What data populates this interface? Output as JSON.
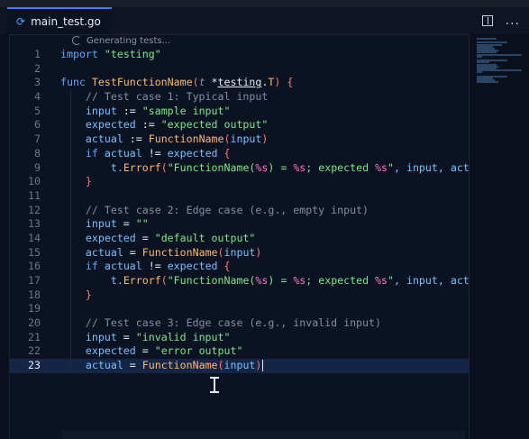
{
  "tab": {
    "icon": "go-file-icon",
    "filename": "main_test.go",
    "dirty_indicator": "modified-dot-icon"
  },
  "editor_actions": {
    "split": "split-editor-icon",
    "more": "more-actions-icon",
    "more_glyph": "..."
  },
  "status": {
    "text": "Generating tests..."
  },
  "code": {
    "lines": [
      {
        "n": "1",
        "tokens": [
          {
            "t": "import ",
            "c": "kw"
          },
          {
            "t": "\"testing\"",
            "c": "str"
          }
        ]
      },
      {
        "n": "2",
        "tokens": []
      },
      {
        "n": "3",
        "tokens": [
          {
            "t": "func ",
            "c": "kw"
          },
          {
            "t": "TestFunctionName",
            "c": "fn"
          },
          {
            "t": "(",
            "c": "punc"
          },
          {
            "t": "t",
            "c": "inlay"
          },
          {
            "t": " *",
            "c": "op"
          },
          {
            "t": "testing",
            "c": "ty ul"
          },
          {
            "t": ".",
            "c": "op"
          },
          {
            "t": "T",
            "c": "fn"
          },
          {
            "t": ") ",
            "c": "punc"
          },
          {
            "t": "{",
            "c": "punc"
          }
        ]
      },
      {
        "n": "4",
        "tokens": [
          {
            "t": "    // Test case 1: Typical input",
            "c": "cm"
          }
        ]
      },
      {
        "n": "5",
        "tokens": [
          {
            "t": "    input",
            "c": "id"
          },
          {
            "t": " := ",
            "c": "op"
          },
          {
            "t": "\"sample input\"",
            "c": "str"
          }
        ]
      },
      {
        "n": "6",
        "tokens": [
          {
            "t": "    expected",
            "c": "id"
          },
          {
            "t": " := ",
            "c": "op"
          },
          {
            "t": "\"expected output\"",
            "c": "str"
          }
        ]
      },
      {
        "n": "7",
        "tokens": [
          {
            "t": "    actual",
            "c": "id"
          },
          {
            "t": " := ",
            "c": "op"
          },
          {
            "t": "FunctionName",
            "c": "fn"
          },
          {
            "t": "(",
            "c": "punc"
          },
          {
            "t": "input",
            "c": "id"
          },
          {
            "t": ")",
            "c": "punc"
          }
        ]
      },
      {
        "n": "8",
        "tokens": [
          {
            "t": "    if ",
            "c": "kw"
          },
          {
            "t": "actual",
            "c": "id"
          },
          {
            "t": " != ",
            "c": "op"
          },
          {
            "t": "expected",
            "c": "id"
          },
          {
            "t": " {",
            "c": "punc"
          }
        ]
      },
      {
        "n": "9",
        "tokens": [
          {
            "t": "        t.",
            "c": "id"
          },
          {
            "t": "Errorf",
            "c": "fn"
          },
          {
            "t": "(",
            "c": "punc"
          },
          {
            "t": "\"FunctionName(",
            "c": "str"
          },
          {
            "t": "%s",
            "c": "fmt"
          },
          {
            "t": ") = ",
            "c": "str"
          },
          {
            "t": "%s",
            "c": "fmt"
          },
          {
            "t": "; expected ",
            "c": "str"
          },
          {
            "t": "%s",
            "c": "fmt"
          },
          {
            "t": "\"",
            "c": "str"
          },
          {
            "t": ", input, act",
            "c": "id"
          }
        ]
      },
      {
        "n": "10",
        "tokens": [
          {
            "t": "    }",
            "c": "punc"
          }
        ]
      },
      {
        "n": "11",
        "tokens": []
      },
      {
        "n": "12",
        "tokens": [
          {
            "t": "    // Test case 2: Edge case (e.g., empty input)",
            "c": "cm"
          }
        ]
      },
      {
        "n": "13",
        "tokens": [
          {
            "t": "    input",
            "c": "id"
          },
          {
            "t": " = ",
            "c": "op"
          },
          {
            "t": "\"\"",
            "c": "str"
          }
        ]
      },
      {
        "n": "14",
        "tokens": [
          {
            "t": "    expected",
            "c": "id"
          },
          {
            "t": " = ",
            "c": "op"
          },
          {
            "t": "\"default output\"",
            "c": "str"
          }
        ]
      },
      {
        "n": "15",
        "tokens": [
          {
            "t": "    actual",
            "c": "id"
          },
          {
            "t": " = ",
            "c": "op"
          },
          {
            "t": "FunctionName",
            "c": "fn"
          },
          {
            "t": "(",
            "c": "punc"
          },
          {
            "t": "input",
            "c": "id"
          },
          {
            "t": ")",
            "c": "punc"
          }
        ]
      },
      {
        "n": "16",
        "tokens": [
          {
            "t": "    if ",
            "c": "kw"
          },
          {
            "t": "actual",
            "c": "id"
          },
          {
            "t": " != ",
            "c": "op"
          },
          {
            "t": "expected",
            "c": "id"
          },
          {
            "t": " {",
            "c": "punc"
          }
        ]
      },
      {
        "n": "17",
        "tokens": [
          {
            "t": "        t.",
            "c": "id"
          },
          {
            "t": "Errorf",
            "c": "fn"
          },
          {
            "t": "(",
            "c": "punc"
          },
          {
            "t": "\"FunctionName(",
            "c": "str"
          },
          {
            "t": "%s",
            "c": "fmt"
          },
          {
            "t": ") = ",
            "c": "str"
          },
          {
            "t": "%s",
            "c": "fmt"
          },
          {
            "t": "; expected ",
            "c": "str"
          },
          {
            "t": "%s",
            "c": "fmt"
          },
          {
            "t": "\"",
            "c": "str"
          },
          {
            "t": ", input, act",
            "c": "id"
          }
        ]
      },
      {
        "n": "18",
        "tokens": [
          {
            "t": "    }",
            "c": "punc"
          }
        ]
      },
      {
        "n": "19",
        "tokens": []
      },
      {
        "n": "20",
        "tokens": [
          {
            "t": "    // Test case 3: Edge case (e.g., invalid input)",
            "c": "cm"
          }
        ]
      },
      {
        "n": "21",
        "tokens": [
          {
            "t": "    input",
            "c": "id"
          },
          {
            "t": " = ",
            "c": "op"
          },
          {
            "t": "\"invalid input\"",
            "c": "str"
          }
        ]
      },
      {
        "n": "22",
        "tokens": [
          {
            "t": "    expected",
            "c": "id"
          },
          {
            "t": " = ",
            "c": "op"
          },
          {
            "t": "\"error output\"",
            "c": "str"
          }
        ]
      },
      {
        "n": "23",
        "active": true,
        "tokens": [
          {
            "t": "    actual",
            "c": "id"
          },
          {
            "t": " = ",
            "c": "op"
          },
          {
            "t": "FunctionName",
            "c": "fn"
          },
          {
            "t": "(",
            "c": "punc"
          },
          {
            "t": "input",
            "c": "id"
          },
          {
            "t": ")",
            "c": "punc"
          }
        ]
      }
    ]
  },
  "colors": {
    "background": "#0b1323",
    "active_line": "#142545",
    "keyword": "#5aa8ff",
    "function": "#ffb86c",
    "string": "#7ee787",
    "comment": "#7f8fa6",
    "identifier": "#79c0ff",
    "tab_accent": "#3a82f7"
  }
}
